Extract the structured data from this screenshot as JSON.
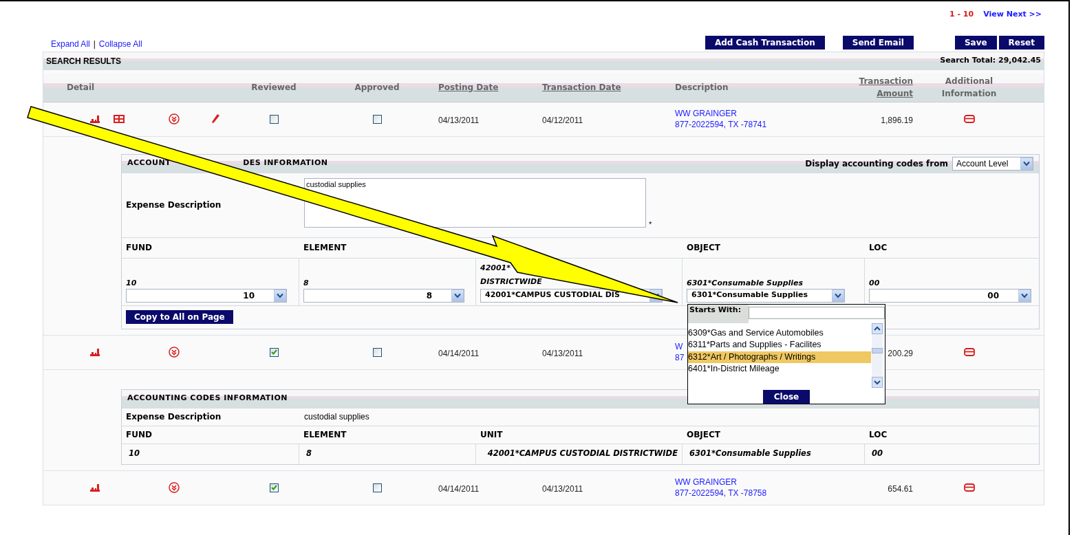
{
  "pagination": {
    "range": "1 - 10",
    "next": "View Next >>"
  },
  "toolbar": {
    "links": [
      "Expand All",
      "Collapse All"
    ],
    "separator": "|",
    "buttons": [
      "Add Cash Transaction",
      "Send Email",
      "Save",
      "Reset"
    ]
  },
  "results": {
    "title": "SEARCH RESULTS",
    "total": "Search Total: 29,042.45",
    "columns": [
      {
        "label": "Detail",
        "sortable": false
      },
      {
        "label": "Reviewed",
        "sortable": false
      },
      {
        "label": "Approved",
        "sortable": false
      },
      {
        "label": "Posting Date",
        "sortable": true
      },
      {
        "label": "Transaction Date",
        "sortable": true
      },
      {
        "label": "Description",
        "sortable": false
      },
      {
        "label": "Transaction Amount",
        "sortable": true
      },
      {
        "label": "Additional Information",
        "sortable": false
      }
    ],
    "rows": [
      {
        "icons": [
          {
            "kind": "chart"
          },
          {
            "kind": "flag"
          },
          {
            "kind": "expand"
          },
          {
            "kind": "edit"
          }
        ],
        "reviewed": false,
        "approved": false,
        "posting_date": "04/13/2011",
        "transaction_date": "04/12/2011",
        "description": [
          "WW GRAINGER",
          "877-2022594, TX -78741"
        ],
        "amount": "1,896.19",
        "panel": {
          "kind": "editable",
          "title_parts": [
            "ACCOUNT",
            "DES INFORMATION"
          ],
          "display_from": {
            "label": "Display accounting codes from",
            "value": "Account Level"
          },
          "expense": {
            "label": "Expense Description",
            "value": "custodial supplies",
            "required_mark": "*"
          },
          "fields": [
            {
              "label": "FUND",
              "current": "10",
              "value": "10",
              "kind": "number"
            },
            {
              "label": "ELEMENT",
              "current": "8",
              "value": "8",
              "kind": "number"
            },
            {
              "current_lines": [
                "42001*",
                "DISTRICTWIDE"
              ],
              "value": "42001*CAMPUS CUSTODIAL DIS",
              "kind": "text"
            },
            {
              "label": "OBJECT",
              "current": "6301*Consumable Supplies",
              "value": "6301*Consumable Supplies",
              "kind": "text"
            },
            {
              "label": "LOC",
              "current": "00",
              "value": "00",
              "kind": "number"
            }
          ],
          "copy_button": "Copy to All on Page",
          "picker": {
            "label": "Starts With:",
            "close": "Close",
            "options": [
              {
                "label": "6309*Gas and Service Automobiles",
                "selected": false
              },
              {
                "label": "6311*Parts and Supplies - Facilites",
                "selected": false
              },
              {
                "label": "6312*Art / Photographs / Writings",
                "selected": true
              },
              {
                "label": "6401*In-District Mileage",
                "selected": false
              }
            ]
          }
        }
      },
      {
        "icons": [
          {
            "kind": "chart"
          },
          {
            "kind": "expand"
          }
        ],
        "reviewed": true,
        "approved": false,
        "posting_date": "04/14/2011",
        "transaction_date": "04/13/2011",
        "description": [
          "W",
          "87"
        ],
        "amount": "200.29",
        "panel": {
          "kind": "readonly",
          "title_parts": [
            "ACCOUNTING CODES INFORMATION"
          ],
          "expense": {
            "label": "Expense Description",
            "value": "custodial supplies"
          },
          "fields": [
            {
              "label": "FUND",
              "current": "10"
            },
            {
              "label": "ELEMENT",
              "current": "8"
            },
            {
              "label": "UNIT",
              "current": "42001*CAMPUS CUSTODIAL DISTRICTWIDE"
            },
            {
              "label": "OBJECT",
              "current": "6301*Consumable Supplies"
            },
            {
              "label": "LOC",
              "current": "00"
            }
          ]
        }
      },
      {
        "icons": [
          {
            "kind": "chart"
          },
          {
            "kind": "expand"
          }
        ],
        "reviewed": true,
        "approved": false,
        "posting_date": "04/14/2011",
        "transaction_date": "04/13/2011",
        "description": [
          "WW GRAINGER",
          "877-2022594, TX -78758"
        ],
        "amount": "654.61"
      }
    ]
  }
}
